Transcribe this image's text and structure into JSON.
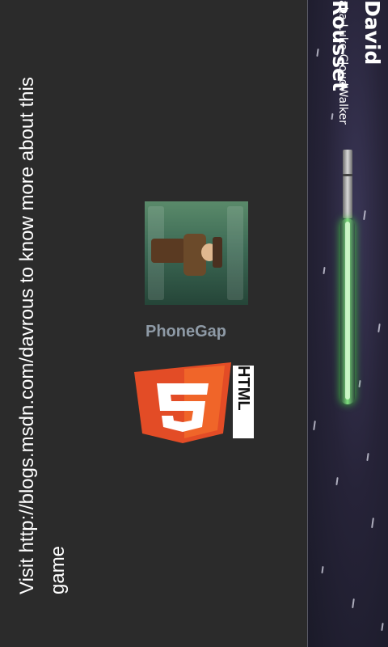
{
  "header": {
    "title": "David Rousset",
    "subtitle": "aka Luke CloudWalker"
  },
  "logos": {
    "game_thumbnail_icon": "adventurer-character-icon",
    "phonegap_text": "PhoneGap",
    "html5_text": "HTML",
    "html5_shield_icon": "html5-shield-icon",
    "html5_accent": "#e34c26"
  },
  "message": "Visit http://blogs.msdn.com/davrous to know more about this game",
  "colors": {
    "background": "#2b2b2b",
    "banner": "#262338",
    "saber_blade": "#7fe07f",
    "text": "#ffffff",
    "phonegap": "#8e9aa6"
  }
}
